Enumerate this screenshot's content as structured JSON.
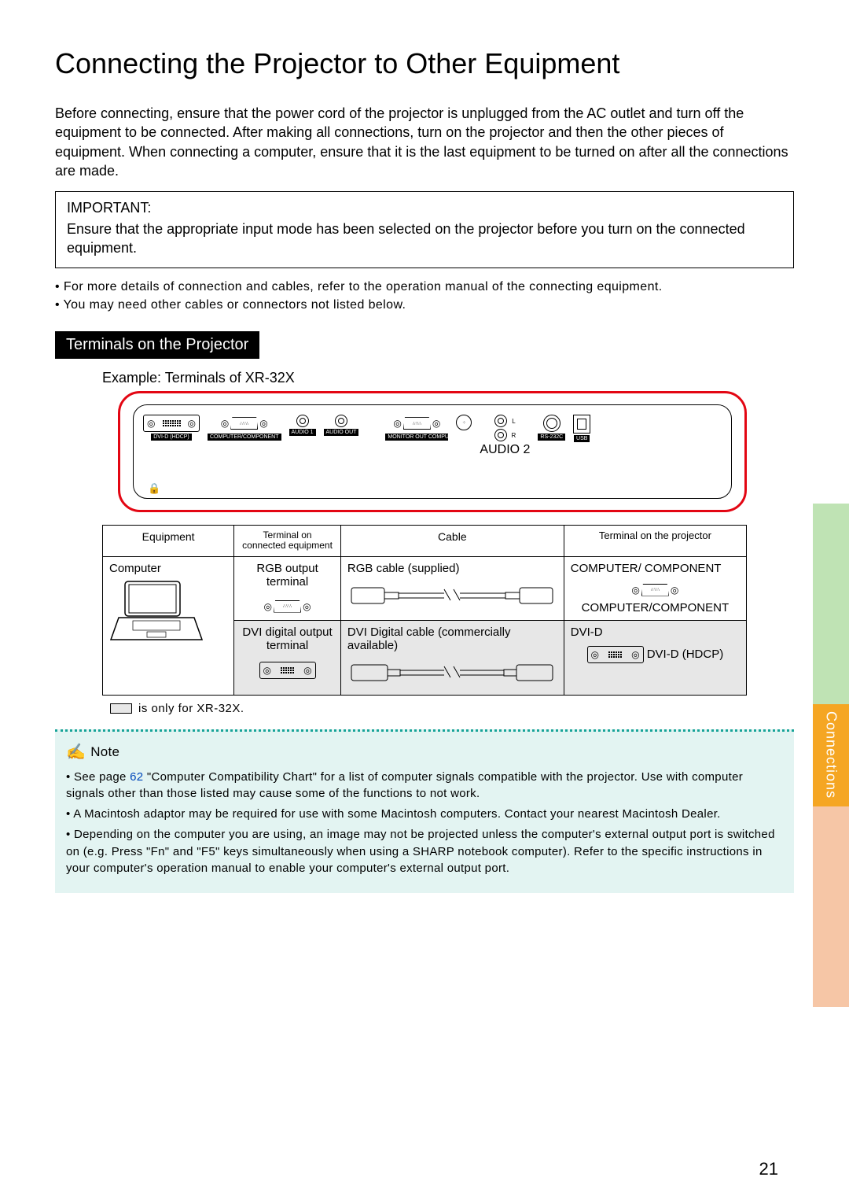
{
  "title": "Connecting the Projector to Other Equipment",
  "intro": "Before connecting, ensure that the power cord of the projector is unplugged from the AC outlet and turn off the equipment to be connected. After making all connections, turn on the projector and then the other pieces of equipment. When connecting a computer, ensure that it is the last equipment to be turned on after all the connections are made.",
  "important": {
    "label": "IMPORTANT:",
    "text": "Ensure that the appropriate input mode has been selected on the projector before you turn on the connected equipment."
  },
  "bullets": {
    "b1": "• For more details of connection and cables, refer to the operation manual of the connecting equipment.",
    "b2": "• You may need other cables or connectors not listed below."
  },
  "section_bar": "Terminals on the Projector",
  "example_label": "Example: Terminals of XR-32X",
  "terminal_labels": {
    "dvi": "DVI-D (HDCP)",
    "computer": "COMPUTER/COMPONENT",
    "audio1": "AUDIO 1",
    "audioout": "AUDIO OUT",
    "monitorout": "MONITOR OUT COMPUTER/COMPONENT",
    "rs232c": "RS-232C",
    "usb": "USB",
    "audio2": "AUDIO 2",
    "l": "L",
    "r": "R"
  },
  "table": {
    "headers": {
      "equipment": "Equipment",
      "term_equip": "Terminal on connected equipment",
      "cable": "Cable",
      "term_proj": "Terminal on the projector"
    },
    "rows": [
      {
        "equipment": "Computer",
        "term_equip": "RGB output terminal",
        "cable": "RGB cable (supplied)",
        "term_proj": "COMPUTER/ COMPONENT",
        "proj_port_label": "COMPUTER/COMPONENT"
      },
      {
        "equipment": "",
        "term_equip": "DVI digital output terminal",
        "cable": "DVI Digital cable (commercially available)",
        "term_proj": "DVI-D",
        "proj_port_label": "DVI-D (HDCP)"
      }
    ]
  },
  "footnote": "is only for XR-32X.",
  "note": {
    "head": "Note",
    "n1a": "• See page ",
    "n1link": "62",
    "n1b": " \"Computer Compatibility Chart\" for a list of computer signals compatible with the projector. Use with computer signals other than those listed may cause some of the functions to not work.",
    "n2": "• A Macintosh adaptor may be required for use with some Macintosh computers. Contact your nearest Macintosh Dealer.",
    "n3": "• Depending on the computer you are using, an image may not be projected unless the computer's external output port is switched on (e.g. Press \"Fn\" and \"F5\" keys simultaneously when using a SHARP notebook computer). Refer to the specific instructions in your computer's operation manual to enable your computer's external output port."
  },
  "side_tab": "Connections",
  "page_number": "21"
}
